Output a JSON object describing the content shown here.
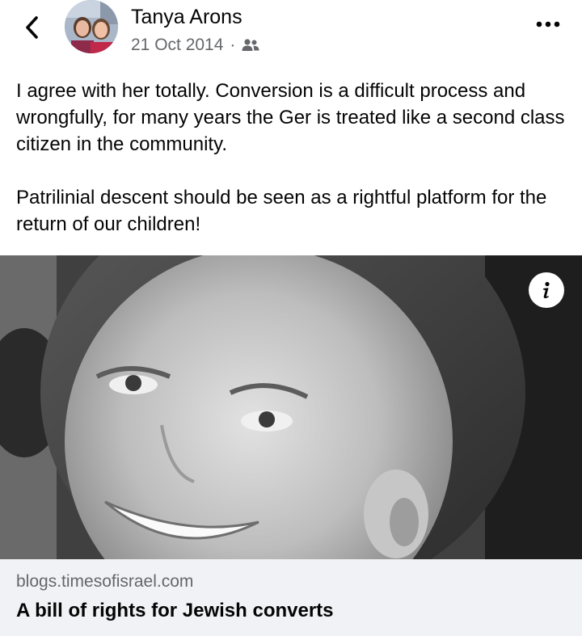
{
  "post": {
    "author": "Tanya Arons",
    "date": "21 Oct 2014",
    "separator": "·",
    "audience_icon": "friends-icon",
    "paragraphs": [
      "I agree with her totally.  Conversion is a difficult process and wrongfully, for many years the Ger is treated like a second class citizen in the community.",
      "Patrilinial descent should be seen as a rightful platform for the return of our children!"
    ]
  },
  "link_preview": {
    "domain": "blogs.timesofisrael.com",
    "title": "A bill of rights for Jewish converts"
  },
  "icons": {
    "back": "back-chevron-icon",
    "more": "more-options-icon",
    "info": "info-icon"
  },
  "colors": {
    "text_primary": "#050505",
    "text_secondary": "#65676b",
    "card_background": "#f0f2f5"
  }
}
